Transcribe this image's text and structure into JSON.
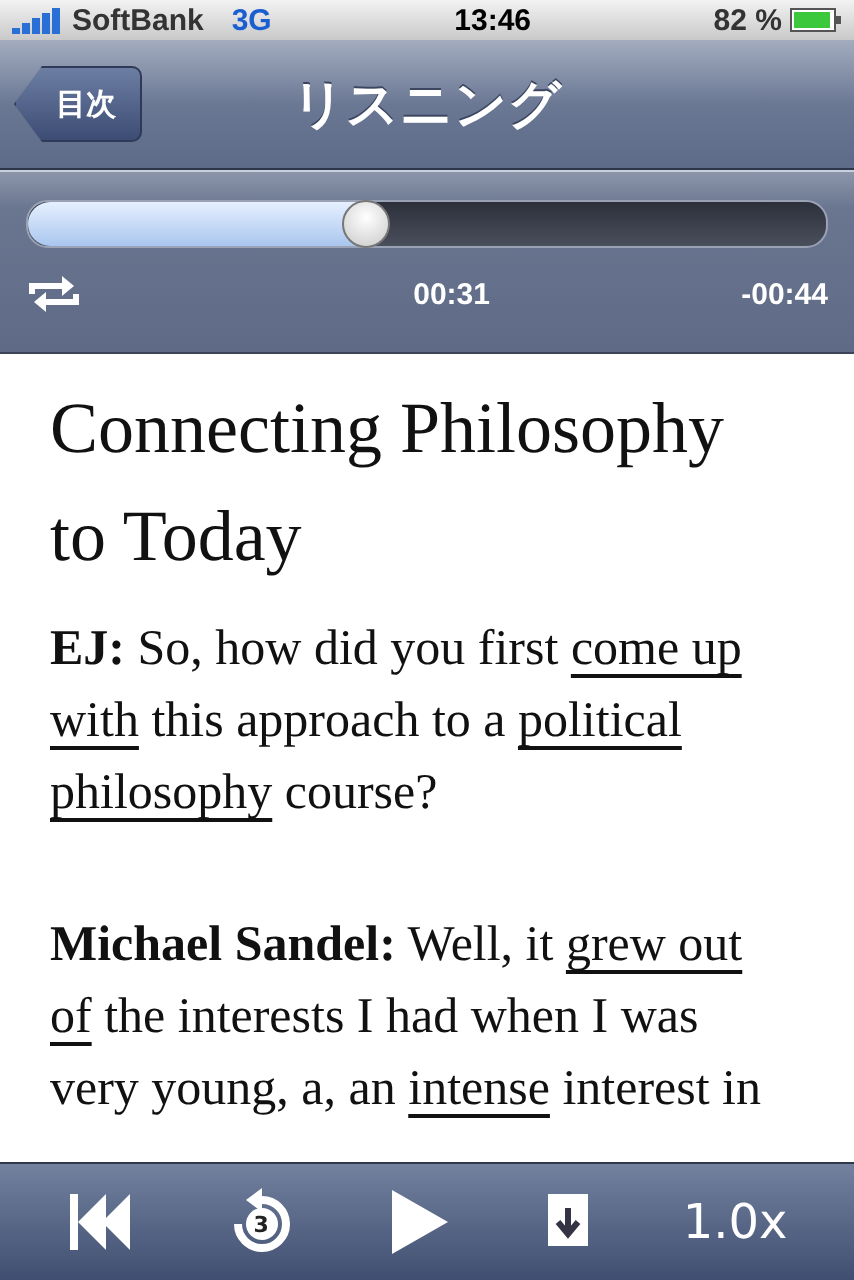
{
  "status_bar": {
    "carrier": "SoftBank",
    "network": "3G",
    "time": "13:46",
    "battery": "82 %"
  },
  "nav_bar": {
    "back": "目次",
    "title": "リスニング"
  },
  "player": {
    "level": 0.42,
    "elapsed": "00:31",
    "remaining": "-00:44"
  },
  "article": {
    "title": "Connecting Philosophy to Today",
    "paragraphs": [
      {
        "speaker": "EJ:",
        "segments": [
          {
            "text": " So, how did you first ",
            "underlined": false
          },
          {
            "text": "come up with",
            "underlined": true
          },
          {
            "text": " this approach to a ",
            "underlined": false
          },
          {
            "text": "political philosophy",
            "underlined": true
          },
          {
            "text": " course?",
            "underlined": false
          }
        ]
      },
      {
        "speaker": "Michael Sandel:",
        "segments": [
          {
            "text": " Well, it ",
            "underlined": false
          },
          {
            "text": "grew out of",
            "underlined": true
          },
          {
            "text": " the interests I had when I was very young, a, an ",
            "underlined": false
          },
          {
            "text": "intense",
            "underlined": true
          },
          {
            "text": " interest in",
            "underlined": false
          }
        ]
      }
    ]
  },
  "toolbar": {
    "rewind_seconds": "3",
    "speed": "1.0x"
  }
}
